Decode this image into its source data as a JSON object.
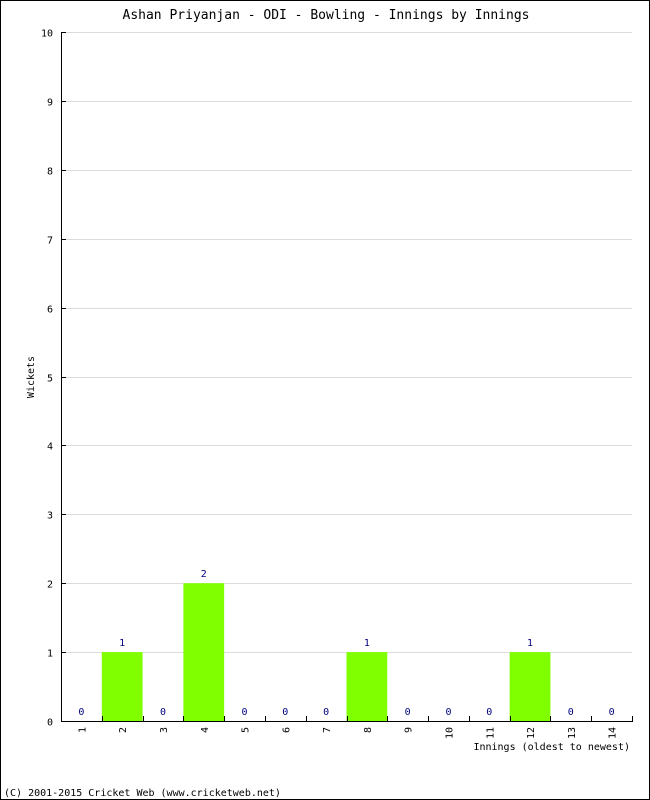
{
  "chart_data": {
    "type": "bar",
    "title": "Ashan Priyanjan - ODI - Bowling - Innings by Innings",
    "xlabel": "Innings (oldest to newest)",
    "ylabel": "Wickets",
    "categories": [
      "1",
      "2",
      "3",
      "4",
      "5",
      "6",
      "7",
      "8",
      "9",
      "10",
      "11",
      "12",
      "13",
      "14"
    ],
    "values": [
      0,
      1,
      0,
      2,
      0,
      0,
      0,
      1,
      0,
      0,
      0,
      1,
      0,
      0
    ],
    "ylim": [
      0,
      10
    ],
    "yticks": [
      0,
      1,
      2,
      3,
      4,
      5,
      6,
      7,
      8,
      9,
      10
    ],
    "grid": true,
    "bar_color": "#80FF00",
    "label_color": "#000080"
  },
  "footer": "(C) 2001-2015 Cricket Web (www.cricketweb.net)"
}
